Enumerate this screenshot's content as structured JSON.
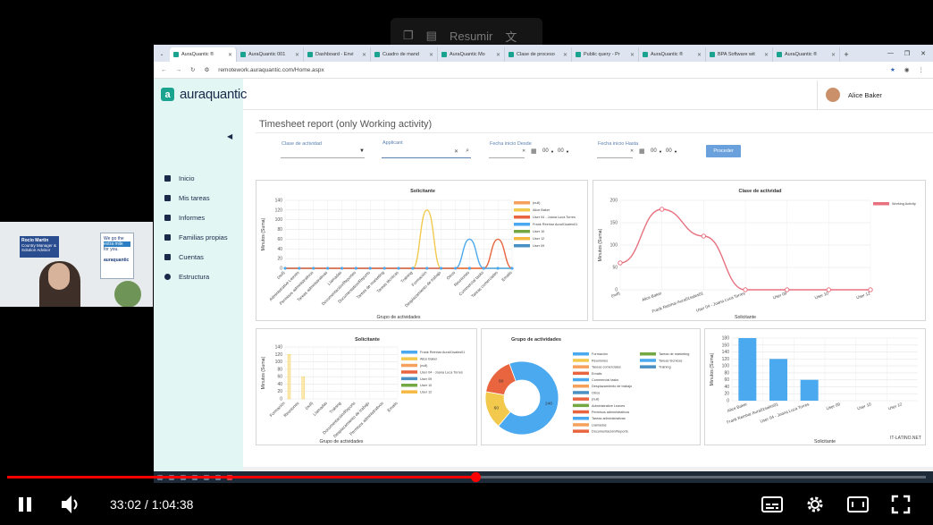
{
  "overlay": {
    "label": "Resumir"
  },
  "webcam": {
    "name": "Rocio Martin",
    "role": "Country Manager & Solution Advisor",
    "board_line1": "We go the",
    "board_line2": "extra mile",
    "board_line3": "for you.",
    "board_brand": "auraquantic"
  },
  "browser": {
    "tabs": [
      "AuraQuantic ®",
      "AuraQuantic 001",
      "Dashboard - Envi",
      "Cuadro de mand",
      "AuraQuantic Mo",
      "Clase de proceso",
      "Public query - Pr",
      "AuraQuantic ®",
      "BPA Software wit",
      "AuraQuantic ®"
    ],
    "url": "remotework.auraquantic.com/Home.aspx"
  },
  "app": {
    "brand": "auraquantic",
    "user": "Alice Baker",
    "page_title": "Timesheet report (only Working activity)",
    "nav": [
      "Inicio",
      "Mis tareas",
      "Informes",
      "Familias propias",
      "Cuentas",
      "Estructura"
    ],
    "filters": {
      "activity_class": "Clase de actividad",
      "applicant": "Applicant",
      "date_from": "Fecha inicio Desde",
      "date_to": "Fecha inicio Hasta",
      "hour": "00",
      "minute": "00",
      "proceed": "Proceder"
    },
    "watermark": "IT-LATINO.NET"
  },
  "chart_data": [
    {
      "type": "line",
      "title": "Solicitante",
      "xlabel": "Grupo de actividades",
      "ylabel": "Minutos (Suma)",
      "categories": [
        "(null)",
        "Administrative Leaves",
        "Permisos administrativos",
        "Tareas administrativas",
        "Llamadas",
        "Documentación/Reportes",
        "Documentation/Reports",
        "Tareas de marketing",
        "Tareas técnicas",
        "Training",
        "Formación",
        "Desplazamiento de trabajo",
        "Otros",
        "Reuniones",
        "Commercial tasks",
        "Tareas comerciales",
        "Emails"
      ],
      "ylim": [
        0,
        140
      ],
      "yticks": [
        0,
        20,
        40,
        60,
        80,
        100,
        120,
        140
      ],
      "legend": [
        "(null)",
        "Alice Baker",
        "User 04 - Joana Luca Torres",
        "Frank Reinhar Aura01sales01",
        "User 10",
        "User 12",
        "User 09"
      ],
      "series": [
        {
          "name": "Alice Baker",
          "values": [
            0,
            0,
            0,
            0,
            0,
            0,
            0,
            0,
            0,
            0,
            120,
            0,
            0,
            0,
            0,
            0,
            0
          ]
        },
        {
          "name": "Frank Reinhar Aura01sales01",
          "values": [
            0,
            0,
            0,
            0,
            0,
            0,
            0,
            0,
            0,
            0,
            0,
            0,
            0,
            60,
            0,
            0,
            0
          ]
        },
        {
          "name": "User 04 - Joana Luca Torres",
          "values": [
            0,
            0,
            0,
            0,
            0,
            0,
            0,
            0,
            0,
            0,
            0,
            0,
            0,
            0,
            0,
            60,
            0
          ]
        }
      ]
    },
    {
      "type": "line",
      "title": "Clase de actividad",
      "xlabel": "Solicitante",
      "ylabel": "Minutos (Suma)",
      "categories": [
        "(null)",
        "Alice Baker",
        "Frank Reinhar Aura01sales01",
        "User 04 - Joana Luca Torres",
        "User 09",
        "User 10",
        "User 12"
      ],
      "ylim": [
        0,
        200
      ],
      "yticks": [
        0,
        50,
        100,
        150,
        200
      ],
      "legend": [
        "Working Activity"
      ],
      "series": [
        {
          "name": "Working Activity",
          "values": [
            60,
            180,
            120,
            0,
            0,
            0,
            0
          ]
        }
      ]
    },
    {
      "type": "bar",
      "title": "Solicitante",
      "xlabel": "Grupo de actividades",
      "ylabel": "Minutos (Suma)",
      "categories": [
        "Formación",
        "Reuniones",
        "(null)",
        "Llamadas",
        "Training",
        "Documentación/Reports",
        "Desplazamiento de trabajo",
        "Permisos administrativos",
        "Emails"
      ],
      "ylim": [
        0,
        140
      ],
      "yticks": [
        0,
        20,
        40,
        60,
        80,
        100,
        120,
        140
      ],
      "legend": [
        "Frank Reinhar Aura01sales01",
        "Alice Baker",
        "(null)",
        "User 04 - Joana Luca Torres",
        "User 09",
        "User 10",
        "User 12"
      ],
      "values": [
        120,
        60,
        0,
        0,
        0,
        0,
        0,
        0,
        0
      ]
    },
    {
      "type": "pie",
      "title": "Grupo de actividades",
      "legend": [
        "Formación",
        "Reuniones",
        "Tareas comerciales",
        "Emails",
        "Commercial tasks",
        "Desplazamiento de trabajo",
        "Otros",
        "(null)",
        "Administrative Leaves",
        "Permisos administrativos",
        "Tareas administrativas",
        "Llamadas",
        "Documentación/Reports",
        "Tareas de marketing",
        "Tareas técnicas",
        "Training"
      ],
      "slices": [
        {
          "label": "Formación",
          "value": 240
        },
        {
          "label": "Reuniones",
          "value": 60
        },
        {
          "label": "Desplazamiento de trabajo",
          "value": 60
        }
      ],
      "labels": [
        "240",
        "60",
        "60"
      ]
    },
    {
      "type": "bar",
      "title": "",
      "xlabel": "Solicitante",
      "ylabel": "Minutos (Suma)",
      "categories": [
        "Alice Baker",
        "Frank Reinhar Aura01sales01",
        "User 04 - Joana Luca Torres",
        "User 09",
        "User 10",
        "User 12"
      ],
      "ylim": [
        0,
        180
      ],
      "yticks": [
        0,
        20,
        40,
        60,
        80,
        100,
        120,
        140,
        160,
        180
      ],
      "values": [
        180,
        120,
        60,
        0,
        0,
        0
      ]
    }
  ],
  "player": {
    "time": "33:02 / 1:04:38",
    "progress": 0.51
  }
}
